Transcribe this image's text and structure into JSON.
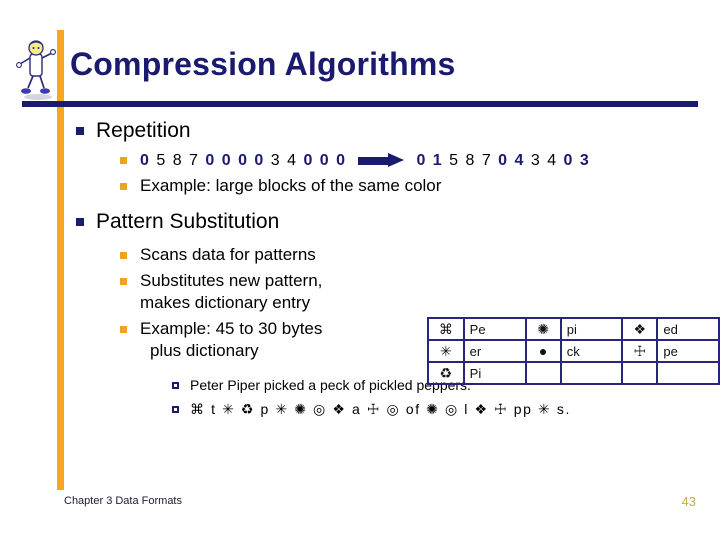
{
  "slide": {
    "title": "Compression Algorithms",
    "footer": "Chapter 3 Data Formats",
    "slide_number": "43",
    "colors": {
      "title_navy": "#1a1a6e",
      "accent_orange": "#f4a81d",
      "bullet_navy": "#1a1a6e",
      "bullet_orange": "#f0a21e",
      "table_border": "#26267c",
      "slide_number_gold": "#c8a84b"
    },
    "clipart_name": "stick-figure-person-clipart"
  },
  "content": {
    "repetition": {
      "heading": "Repetition",
      "sequence_before": [
        {
          "text": "0",
          "style": "zero"
        },
        {
          "text": "5",
          "style": "other"
        },
        {
          "text": "8",
          "style": "other"
        },
        {
          "text": "7",
          "style": "other"
        },
        {
          "text": "0",
          "style": "zero"
        },
        {
          "text": "0",
          "style": "zero"
        },
        {
          "text": "0",
          "style": "zero"
        },
        {
          "text": "0",
          "style": "zero"
        },
        {
          "text": "3",
          "style": "other"
        },
        {
          "text": "4",
          "style": "other"
        },
        {
          "text": "0",
          "style": "zero"
        },
        {
          "text": "0",
          "style": "zero"
        },
        {
          "text": "0",
          "style": "zero"
        }
      ],
      "arrow_icon": "right-arrow-icon",
      "sequence_after": [
        {
          "text": "0",
          "style": "zero"
        },
        {
          "text": "1",
          "style": "zero"
        },
        {
          "text": "5",
          "style": "other"
        },
        {
          "text": "8",
          "style": "other"
        },
        {
          "text": "7",
          "style": "other"
        },
        {
          "text": "0",
          "style": "zero"
        },
        {
          "text": "4",
          "style": "zero"
        },
        {
          "text": "3",
          "style": "other"
        },
        {
          "text": "4",
          "style": "other"
        },
        {
          "text": "0",
          "style": "zero"
        },
        {
          "text": "3",
          "style": "zero"
        }
      ],
      "example": "Example:  large blocks of the same color"
    },
    "pattern_substitution": {
      "heading": "Pattern Substitution",
      "points": [
        "Scans data for patterns",
        "Substitutes new pattern,",
        "makes dictionary entry",
        "Example: 45 to 30 bytes",
        "plus dictionary"
      ],
      "point_1": "Scans data for patterns",
      "point_2_line1": "Substitutes new pattern,",
      "point_2_line2": "makes dictionary entry",
      "point_3_line1": "Example: 45 to 30 bytes",
      "point_3_line2": "plus dictionary"
    },
    "dictionary_table": {
      "rows": [
        [
          {
            "symbol": "⌘",
            "symbol_name": "place-of-interest-icon",
            "text": "Pe"
          },
          {
            "symbol": "✺",
            "symbol_name": "sixteen-pointed-asterisk-icon",
            "text": "pi"
          },
          {
            "symbol": "❖",
            "symbol_name": "four-diamond-cluster-icon",
            "text": "ed"
          }
        ],
        [
          {
            "symbol": "✳",
            "symbol_name": "eight-spoked-asterisk-icon",
            "text": "er"
          },
          {
            "symbol": "●",
            "symbol_name": "filled-circle-icon",
            "text": "ck"
          },
          {
            "symbol": "☩",
            "symbol_name": "cross-of-jerusalem-icon",
            "text": "pe"
          }
        ],
        [
          {
            "symbol": "♻",
            "symbol_name": "recycling-circle-icon",
            "text": "Pi"
          },
          {
            "symbol": "",
            "symbol_name": "empty-cell",
            "text": ""
          },
          {
            "symbol": "",
            "symbol_name": "empty-cell",
            "text": ""
          }
        ]
      ]
    },
    "example_lines": {
      "plain": "Peter Piper picked a peck of pickled peppers.",
      "encoded": "⌘ t ✳ ♻ p ✳ ✺ ◎ ❖ a ☩ ◎ of ✺ ◎ l ❖ ☩ pp ✳ s."
    }
  }
}
